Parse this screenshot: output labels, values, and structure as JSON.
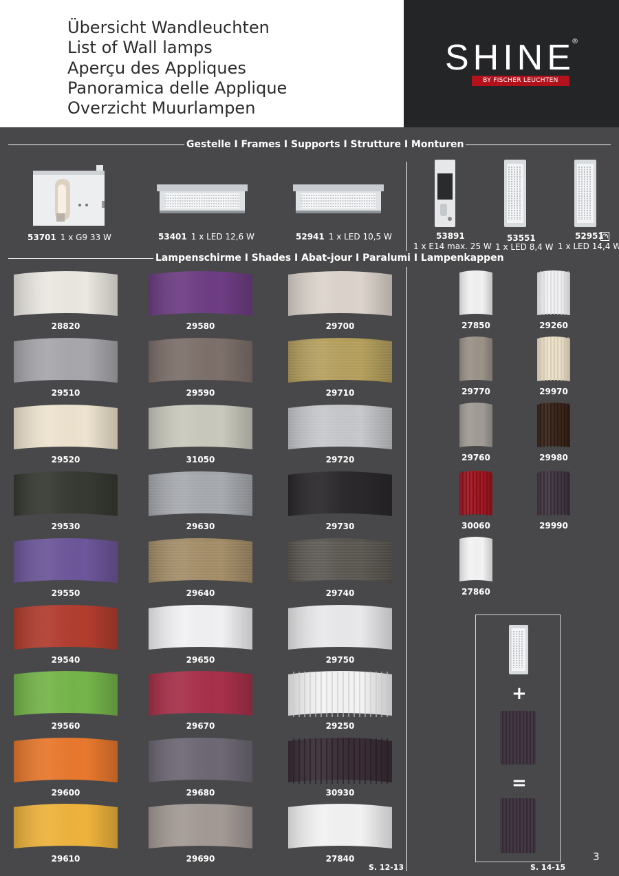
{
  "header": {
    "titles": [
      "Übersicht Wandleuchten",
      "List of Wall lamps",
      "Aperçu des Appliques",
      "Panoramica delle Applique",
      "Overzicht Muurlampen"
    ],
    "logo": {
      "name": "SHINE",
      "registered": "®",
      "tagline": "BY FISCHER LEUCHTEN"
    }
  },
  "colors": {
    "background": "#48484a",
    "header_dark": "#242527",
    "brand_red": "#b3111b"
  },
  "frames_section": {
    "heading": "Gestelle I Frames I Supports I Strutture I Monturen",
    "items": [
      {
        "code": "53701",
        "spec": "1 x G9 33 W"
      },
      {
        "code": "53401",
        "spec": "1 x LED 12,6 W"
      },
      {
        "code": "52941",
        "spec": "1 x LED 10,5 W"
      },
      {
        "code": "53891",
        "spec": "1 x E14 max. 25 W"
      },
      {
        "code": "53551",
        "spec": "1 x LED 8,4 W"
      },
      {
        "code": "52951",
        "spec": "1 x LED 14,4 W",
        "icon": "dimmer-icon"
      }
    ]
  },
  "shades_section": {
    "heading": "Lampenschirme I Shades I Abat-jour I Paralumi I Lampenkappen",
    "wide": [
      {
        "code": "28820",
        "color": "#ebe8e2"
      },
      {
        "code": "29580",
        "color": "#6e3d84"
      },
      {
        "code": "29700",
        "color": "#dcd4cc"
      },
      {
        "code": "29510",
        "color": "#a7a7ac"
      },
      {
        "code": "29590",
        "color": "#7d706a"
      },
      {
        "code": "29710",
        "color": "#b39d5a"
      },
      {
        "code": "29520",
        "color": "#eee3cf"
      },
      {
        "code": "31050",
        "color": "#c9c9bd"
      },
      {
        "code": "29720",
        "color": "#c4c6c9"
      },
      {
        "code": "29530",
        "color": "#363a32"
      },
      {
        "code": "29630",
        "color": "#a4a7ac"
      },
      {
        "code": "29730",
        "color": "#2b282c"
      },
      {
        "code": "29550",
        "color": "#6d569a"
      },
      {
        "code": "29640",
        "color": "#a28b65"
      },
      {
        "code": "29740",
        "color": "#58544e"
      },
      {
        "code": "29540",
        "color": "#b23d2f"
      },
      {
        "code": "29650",
        "color": "#f1f1f3"
      },
      {
        "code": "29750",
        "color": "#e9e8ea"
      },
      {
        "code": "29560",
        "color": "#75b54a"
      },
      {
        "code": "29670",
        "color": "#a8304a"
      },
      {
        "code": "29250",
        "color": "#f4f4f4"
      },
      {
        "code": "29600",
        "color": "#e8782d"
      },
      {
        "code": "29680",
        "color": "#6d6874"
      },
      {
        "code": "30930",
        "color": "#3a2d36"
      },
      {
        "code": "29610",
        "color": "#eeb33c"
      },
      {
        "code": "29690",
        "color": "#a39a95"
      },
      {
        "code": "27840",
        "color": "#f2f2f2"
      }
    ],
    "narrow": [
      {
        "code": "27850",
        "color": "#f1f1f1"
      },
      {
        "code": "29260",
        "color": "#f4f4f6"
      },
      {
        "code": "29770",
        "color": "#9b9288"
      },
      {
        "code": "29970",
        "color": "#ece2cc"
      },
      {
        "code": "29760",
        "color": "#a09b95"
      },
      {
        "code": "29980",
        "color": "#3b261b"
      },
      {
        "code": "30060",
        "color": "#a31823"
      },
      {
        "code": "29990",
        "color": "#433844"
      },
      {
        "code": "27860",
        "color": "#f3f3f3"
      }
    ],
    "page_refs": {
      "left": "S. 12-13",
      "right": "S. 14-15"
    },
    "combo": {
      "plus": "+",
      "equals": "="
    }
  },
  "page_number": "3"
}
